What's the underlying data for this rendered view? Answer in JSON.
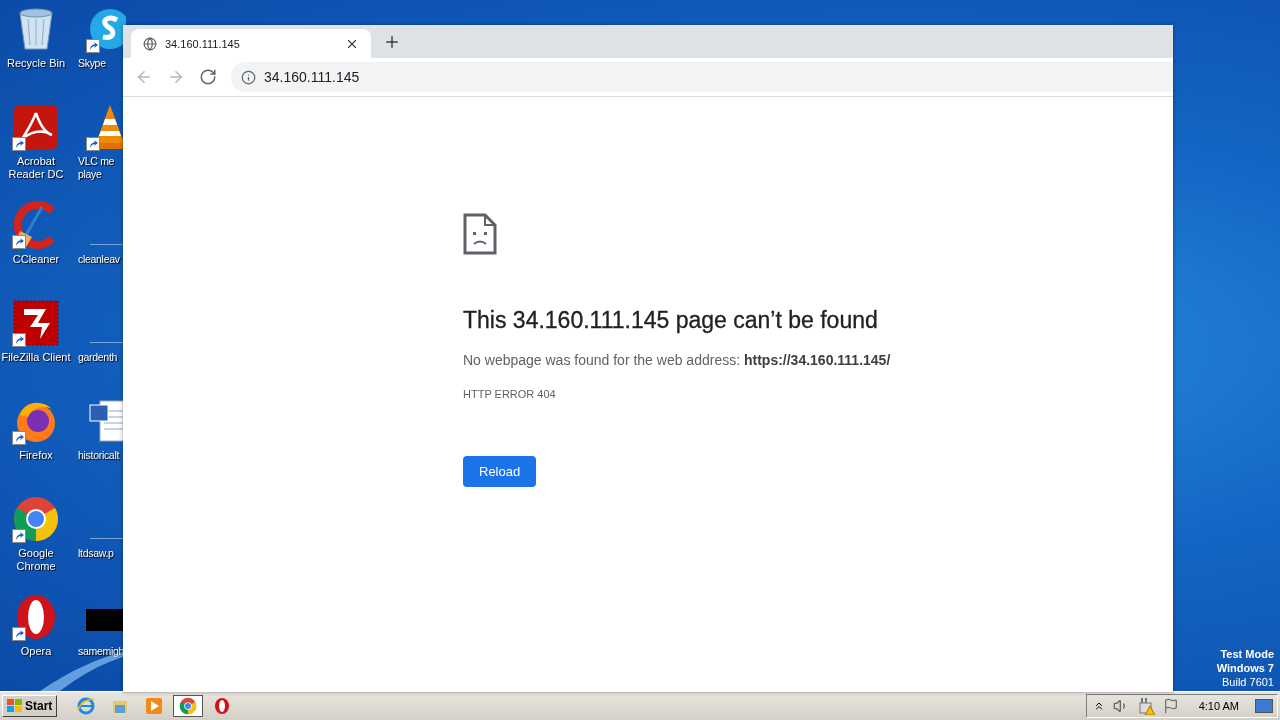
{
  "desktop": {
    "icons": [
      {
        "kind": "recycle",
        "label": "Recycle Bin",
        "shortcut": false
      },
      {
        "kind": "skype",
        "label": "Skype",
        "shortcut": true
      },
      {
        "kind": "acrobat",
        "label": "Acrobat Reader DC",
        "shortcut": true
      },
      {
        "kind": "vlc",
        "label": "VLC me playe",
        "shortcut": true
      },
      {
        "kind": "ccleaner",
        "label": "CCleaner",
        "shortcut": true
      },
      {
        "kind": "file",
        "label": "cleanleav",
        "shortcut": false
      },
      {
        "kind": "filezilla",
        "label": "FileZilla Client",
        "shortcut": true
      },
      {
        "kind": "file",
        "label": "gardenth",
        "shortcut": false
      },
      {
        "kind": "firefox",
        "label": "Firefox",
        "shortcut": true
      },
      {
        "kind": "word",
        "label": "historicalt",
        "shortcut": false
      },
      {
        "kind": "chrome",
        "label": "Google Chrome",
        "shortcut": true
      },
      {
        "kind": "file",
        "label": "ltdsaw.p",
        "shortcut": false
      },
      {
        "kind": "opera",
        "label": "Opera",
        "shortcut": true
      },
      {
        "kind": "dark",
        "label": "samemigh",
        "shortcut": false
      }
    ],
    "os_notice": [
      "Test Mode",
      "Windows 7",
      "Build 7601"
    ]
  },
  "browser": {
    "tabs": [
      {
        "title": "34.160.111.145",
        "selected": true
      }
    ],
    "nav_buttons": [
      {
        "kind": "back",
        "disabled": true
      },
      {
        "kind": "forward",
        "disabled": true
      },
      {
        "kind": "reload",
        "disabled": false
      }
    ],
    "address": "34.160.111.145",
    "error_page": {
      "heading": "This 34.160.111.145 page can’t be found",
      "message": "No webpage was found for the web address: **https://34.160.111.145/**",
      "code": "HTTP ERROR 404",
      "button": "Reload"
    }
  },
  "taskbar": {
    "start": "Start",
    "apps": [
      {
        "kind": "ie",
        "selected": false
      },
      {
        "kind": "explorer",
        "selected": false
      },
      {
        "kind": "media",
        "selected": false
      },
      {
        "kind": "chrome",
        "selected": true
      },
      {
        "kind": "opera",
        "selected": false
      }
    ],
    "clock": "4:10 AM"
  }
}
